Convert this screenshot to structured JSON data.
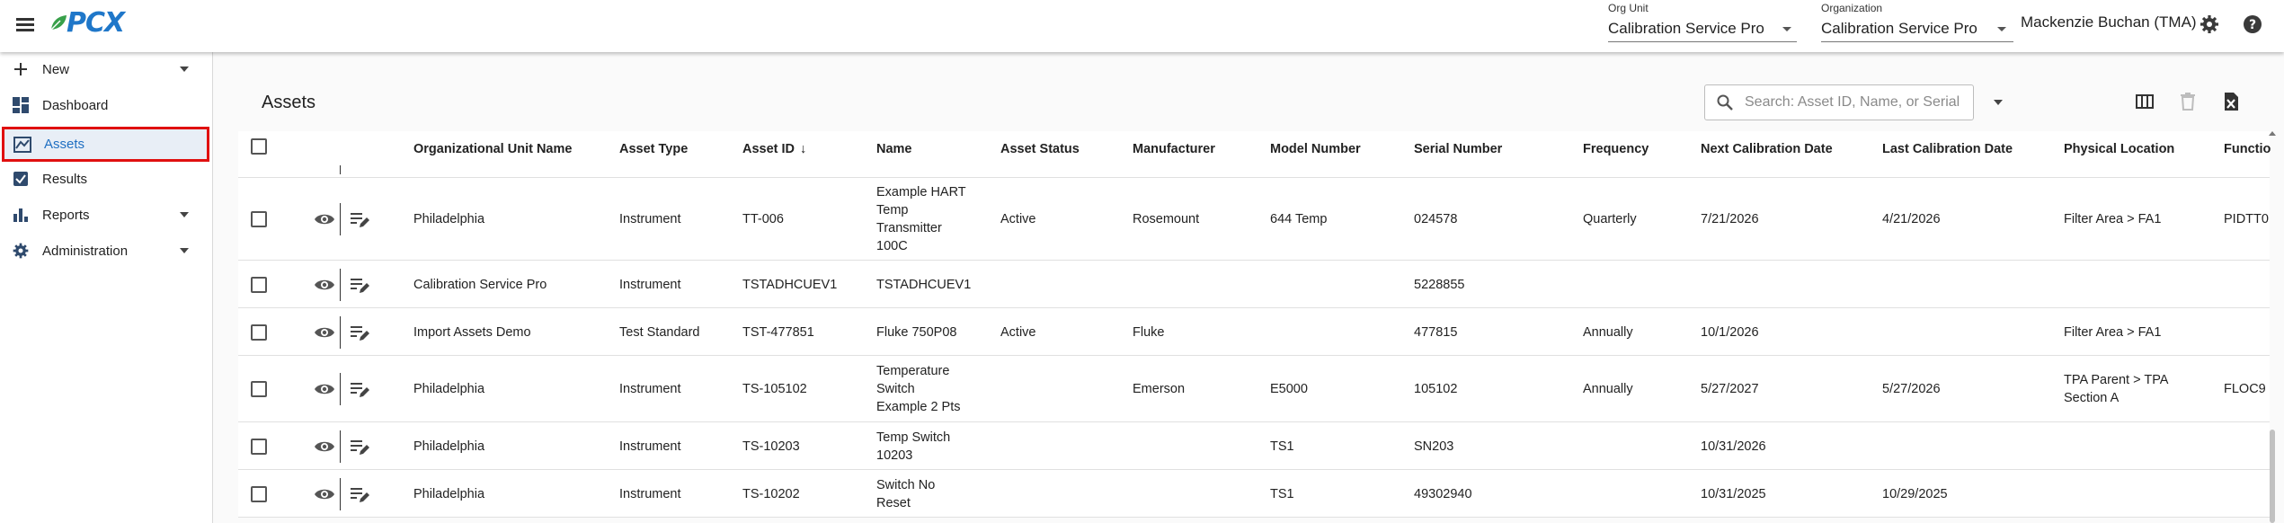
{
  "app": {
    "logo_text": "PCX"
  },
  "header": {
    "org_unit_label": "Org Unit",
    "org_unit_value": "Calibration Service Pro",
    "organization_label": "Organization",
    "organization_value": "Calibration Service Pro",
    "user_name": "Mackenzie Buchan (TMA)"
  },
  "sidebar": {
    "items": [
      {
        "label": "New",
        "icon": "plus-icon",
        "has_caret": true
      },
      {
        "label": "Dashboard",
        "icon": "dashboard-icon",
        "has_caret": false
      },
      {
        "label": "Assets",
        "icon": "assets-icon",
        "has_caret": false,
        "active": true
      },
      {
        "label": "Results",
        "icon": "checklist-icon",
        "has_caret": false
      },
      {
        "label": "Reports",
        "icon": "bar-chart-icon",
        "has_caret": true
      },
      {
        "label": "Administration",
        "icon": "gear-icon",
        "has_caret": true
      }
    ]
  },
  "page": {
    "title": "Assets",
    "search_placeholder": "Search: Asset ID, Name, or Serial"
  },
  "table": {
    "columns": [
      "Organizational Unit Name",
      "Asset Type",
      "Asset ID",
      "Name",
      "Asset Status",
      "Manufacturer",
      "Model Number",
      "Serial Number",
      "Frequency",
      "Next Calibration Date",
      "Last Calibration Date",
      "Physical Location",
      "Functio"
    ],
    "sort_indicator": "↓",
    "rows": [
      {
        "org_unit": "Philadelphia",
        "asset_type": "Instrument",
        "asset_id": "TT-006",
        "name_lines": [
          "Example HART",
          "Temp",
          "Transmitter",
          "100C"
        ],
        "status": "Active",
        "manufacturer": "Rosemount",
        "model": "644 Temp",
        "serial": "024578",
        "frequency": "Quarterly",
        "next_cal": "7/21/2026",
        "last_cal": "4/21/2026",
        "location_lines": [
          "Filter Area > FA1"
        ],
        "function": "PIDTT0"
      },
      {
        "org_unit": "Calibration Service Pro",
        "asset_type": "Instrument",
        "asset_id": "TSTADHCUEV1",
        "name_lines": [
          "TSTADHCUEV1"
        ],
        "status": "",
        "manufacturer": "",
        "model": "",
        "serial": "5228855",
        "frequency": "",
        "next_cal": "",
        "last_cal": "",
        "location_lines": [],
        "function": ""
      },
      {
        "org_unit": "Import Assets Demo",
        "asset_type": "Test Standard",
        "asset_id": "TST-477851",
        "name_lines": [
          "Fluke 750P08"
        ],
        "status": "Active",
        "manufacturer": "Fluke",
        "model": "",
        "serial": "477815",
        "frequency": "Annually",
        "next_cal": "10/1/2026",
        "last_cal": "",
        "location_lines": [
          "Filter Area > FA1"
        ],
        "function": ""
      },
      {
        "org_unit": "Philadelphia",
        "asset_type": "Instrument",
        "asset_id": "TS-105102",
        "name_lines": [
          "Temperature",
          "Switch",
          "Example 2 Pts"
        ],
        "status": "",
        "manufacturer": "Emerson",
        "model": "E5000",
        "serial": "105102",
        "frequency": "Annually",
        "next_cal": "5/27/2027",
        "last_cal": "5/27/2026",
        "location_lines": [
          "TPA Parent > TPA",
          "Section A"
        ],
        "function": "FLOC9"
      },
      {
        "org_unit": "Philadelphia",
        "asset_type": "Instrument",
        "asset_id": "TS-10203",
        "name_lines": [
          "Temp Switch",
          "10203"
        ],
        "status": "",
        "manufacturer": "",
        "model": "TS1",
        "serial": "SN203",
        "frequency": "",
        "next_cal": "10/31/2026",
        "last_cal": "",
        "location_lines": [],
        "function": ""
      },
      {
        "org_unit": "Philadelphia",
        "asset_type": "Instrument",
        "asset_id": "TS-10202",
        "name_lines": [
          "Switch No",
          "Reset"
        ],
        "status": "",
        "manufacturer": "",
        "model": "TS1",
        "serial": "49302940",
        "frequency": "",
        "next_cal": "10/31/2025",
        "last_cal": "10/29/2025",
        "location_lines": [],
        "function": ""
      }
    ]
  },
  "colors": {
    "accent": "#1f77c9",
    "highlight_border": "#e01010",
    "active_bg": "#e8eef6"
  }
}
